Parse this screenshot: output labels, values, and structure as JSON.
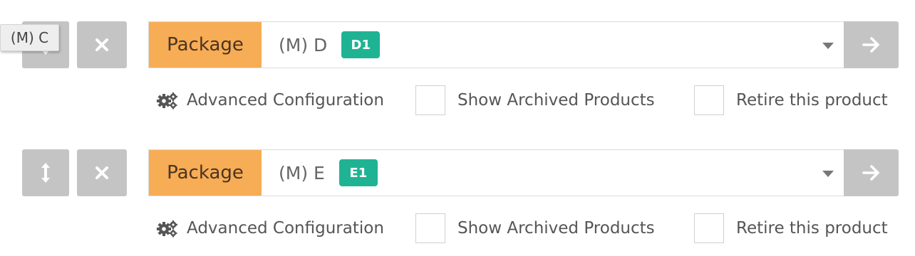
{
  "tooltip": {
    "text": "(M) C"
  },
  "rows": [
    {
      "package_label": "Package",
      "selected_value": "(M) D",
      "version_badge": "D1",
      "advanced_config_label": "Advanced Configuration",
      "show_archived_label": "Show Archived Products",
      "retire_label": "Retire this product",
      "icons": {
        "move": "vertical-arrows-icon",
        "remove": "close-icon",
        "dropdown": "caret-down-icon",
        "go": "arrow-right-icon",
        "config": "gears-icon"
      }
    },
    {
      "package_label": "Package",
      "selected_value": "(M) E",
      "version_badge": "E1",
      "advanced_config_label": "Advanced Configuration",
      "show_archived_label": "Show Archived Products",
      "retire_label": "Retire this product",
      "icons": {
        "move": "vertical-arrows-icon",
        "remove": "close-icon",
        "dropdown": "caret-down-icon",
        "go": "arrow-right-icon",
        "config": "gears-icon"
      }
    }
  ],
  "colors": {
    "package_label_bg": "#f7ac56",
    "version_badge_bg": "#1fb394",
    "button_gray": "#c4c4c4"
  }
}
